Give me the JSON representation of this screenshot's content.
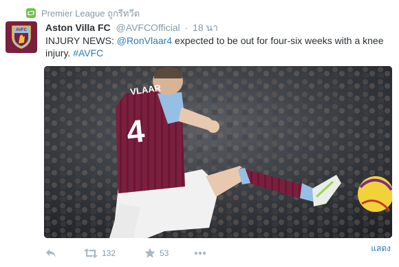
{
  "context": {
    "retweeted_by_label": "Premier League ถูกรีทวีต",
    "icon": "retweet-icon",
    "accent_color": "#6ec14b"
  },
  "tweet": {
    "author_name": "Aston Villa FC",
    "screen_name": "@AVFCOfficial",
    "separator": "·",
    "timestamp": "18 นา",
    "text_prefix": "INJURY NEWS: ",
    "mention": "@RonVlaar4",
    "text_body": " expected to be out for four-six weeks with a knee injury. ",
    "hashtag": "#AVFC",
    "avatar": {
      "icon": "avfc-crest-icon",
      "badge_text": "AVFC",
      "color": "#7b1f3f"
    }
  },
  "media": {
    "shirt_name": "VLAAR",
    "shirt_number": "4",
    "kit_color": "#7b1f3f",
    "sleeve_color": "#95bfe5"
  },
  "expand_label": "แสดง",
  "actions": {
    "reply_icon": "reply-icon",
    "retweet_icon": "retweet-icon",
    "retweet_count": "132",
    "favorite_icon": "star-icon",
    "favorite_count": "53",
    "more_icon": "more-icon"
  },
  "colors": {
    "link": "#2b7bb9",
    "muted": "#8899a6",
    "text": "#292f33"
  }
}
